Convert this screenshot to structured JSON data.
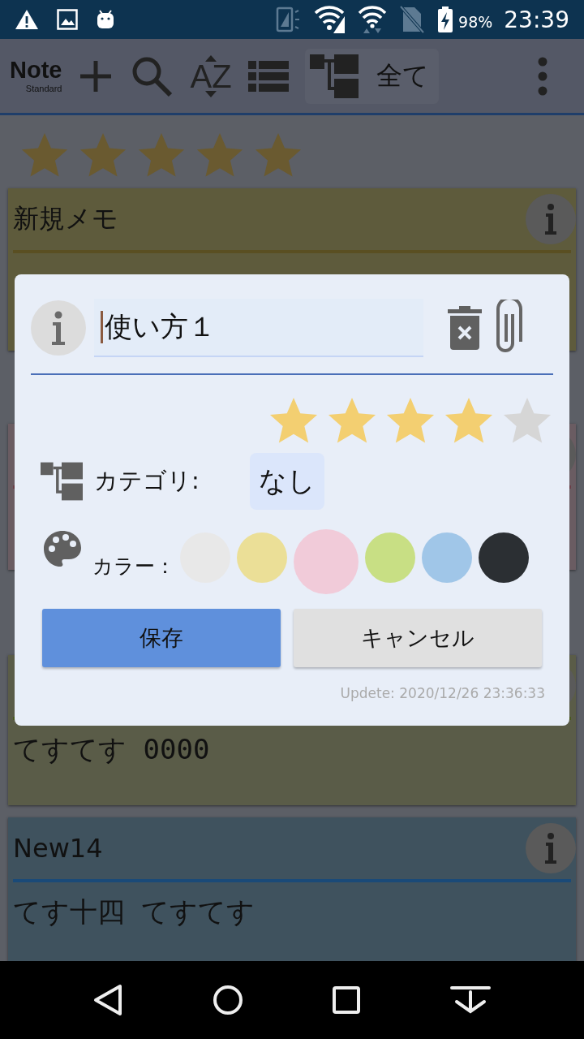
{
  "status_bar": {
    "battery": "98%",
    "time": "23:39"
  },
  "toolbar": {
    "logo": "Note",
    "edition": "Standard",
    "sort_label": "AZ",
    "category": "全て"
  },
  "notes": [
    {
      "stars": 5,
      "title": "新規メモ",
      "color": "#5e5b3c",
      "divider": {
        "color": "#5a4f22"
      }
    },
    {
      "color": "#6a5c62",
      "divider": {
        "color": "#6a3f48"
      }
    },
    {
      "color": "#5a5c48",
      "divider": {
        "color": "#4a5a20"
      },
      "body": "てすてす 0000"
    },
    {
      "color": "#3f525e",
      "divider": {
        "color": "#1a4a78"
      },
      "title": "New14",
      "body": "てす十四 てすてす"
    }
  ],
  "dialog": {
    "title": "使い方１",
    "stars": 4,
    "category_label": "カテゴリ:",
    "category": "なし",
    "color_label": "カラー：",
    "colors": [
      {
        "color": "#e8e8e8",
        "selected": false
      },
      {
        "color": "#ebdf97",
        "selected": false
      },
      {
        "color": "#f1cbd9",
        "selected": true
      },
      {
        "color": "#c8df84",
        "selected": false
      },
      {
        "color": "#a0c6e8",
        "selected": false
      },
      {
        "color": "#2b2f33",
        "selected": false
      }
    ],
    "save": "保存",
    "cancel": "キャンセル",
    "updated": "Updete: 2020/12/26 23:36:33"
  }
}
